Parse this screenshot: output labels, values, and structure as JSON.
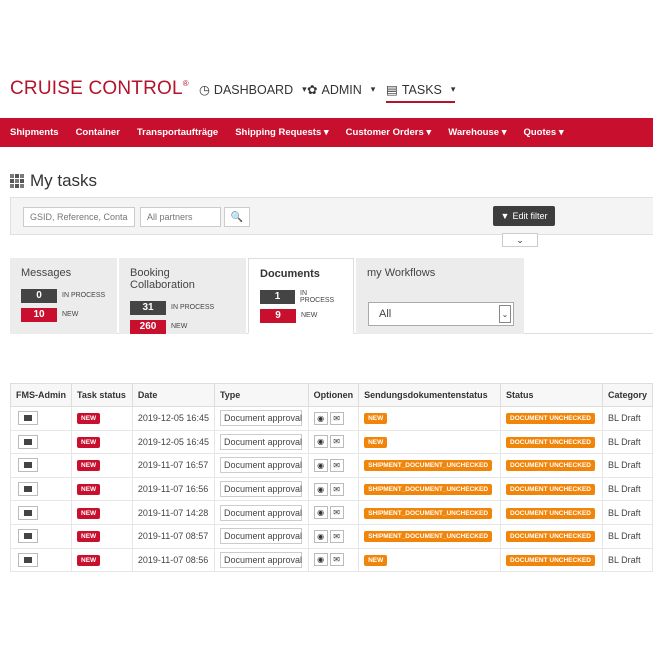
{
  "brand": {
    "name": "CRUISE CONTROL",
    "mark": "®"
  },
  "topnav": [
    {
      "icon": "clock-icon",
      "glyph": "◷",
      "label": "DASHBOARD"
    },
    {
      "icon": "gear-icon",
      "glyph": "✿",
      "label": "ADMIN"
    },
    {
      "icon": "tasks-icon",
      "glyph": "▤",
      "label": "TASKS"
    }
  ],
  "rednav": [
    "Shipments",
    "Container",
    "Transportaufträge",
    "Shipping Requests ▾",
    "Customer Orders ▾",
    "Warehouse ▾",
    "Quotes ▾"
  ],
  "page_title": "My tasks",
  "filter": {
    "search_placeholder": "GSID, Reference, Conta",
    "partners_placeholder": "All partners",
    "search_glyph": "🔍",
    "edit_filter": "Edit filter",
    "chevron": "⌄"
  },
  "tabs": [
    {
      "title": "Messages",
      "in_process": "0",
      "new": "10",
      "in_process_label": "IN PROCESS",
      "new_label": "NEW"
    },
    {
      "title": "Booking Collaboration",
      "in_process": "31",
      "new": "260",
      "in_process_label": "IN PROCESS",
      "new_label": "NEW"
    },
    {
      "title": "Documents",
      "in_process": "1",
      "new": "9",
      "in_process_label": "IN PROCESS",
      "new_label": "NEW"
    },
    {
      "title": "my Workflows",
      "select_value": "All",
      "select_arrow": "⌄"
    }
  ],
  "table": {
    "headers": [
      "FMS-Admin",
      "Task status",
      "Date",
      "Type",
      "Optionen",
      "Sendungsdokumentenstatus",
      "Status",
      "Category"
    ],
    "rows": [
      {
        "status": "NEW",
        "date": "2019-12-05 16:45",
        "type": "Document approval",
        "doc_status": "NEW",
        "state": "DOCUMENT UNCHECKED",
        "category": "BL Draft"
      },
      {
        "status": "NEW",
        "date": "2019-12-05 16:45",
        "type": "Document approval",
        "doc_status": "NEW",
        "state": "DOCUMENT UNCHECKED",
        "category": "BL Draft"
      },
      {
        "status": "NEW",
        "date": "2019-11-07 16:57",
        "type": "Document approval",
        "doc_status": "SHIPMENT_DOCUMENT_UNCHECKED",
        "state": "DOCUMENT UNCHECKED",
        "category": "BL Draft"
      },
      {
        "status": "NEW",
        "date": "2019-11-07 16:56",
        "type": "Document approval",
        "doc_status": "SHIPMENT_DOCUMENT_UNCHECKED",
        "state": "DOCUMENT UNCHECKED",
        "category": "BL Draft"
      },
      {
        "status": "NEW",
        "date": "2019-11-07 14:28",
        "type": "Document approval",
        "doc_status": "SHIPMENT_DOCUMENT_UNCHECKED",
        "state": "DOCUMENT UNCHECKED",
        "category": "BL Draft"
      },
      {
        "status": "NEW",
        "date": "2019-11-07 08:57",
        "type": "Document approval",
        "doc_status": "SHIPMENT_DOCUMENT_UNCHECKED",
        "state": "DOCUMENT UNCHECKED",
        "category": "BL Draft"
      },
      {
        "status": "NEW",
        "date": "2019-11-07 08:56",
        "type": "Document approval",
        "doc_status": "NEW",
        "state": "DOCUMENT UNCHECKED",
        "category": "BL Draft"
      }
    ],
    "option_glyphs": {
      "view": "◉",
      "mail": "✉"
    }
  },
  "colors": {
    "brand_red": "#c8102e",
    "badge_orange": "#f0850a",
    "dark": "#444444"
  }
}
